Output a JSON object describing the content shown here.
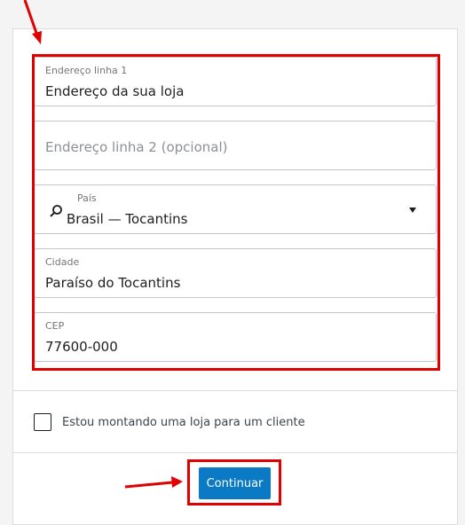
{
  "form": {
    "address1": {
      "label": "Endereço linha 1",
      "value": "Endereço da sua loja"
    },
    "address2": {
      "placeholder": "Endereço linha 2 (opcional)"
    },
    "country": {
      "label": "País",
      "value": "Brasil — Tocantins"
    },
    "city": {
      "label": "Cidade",
      "value": "Paraíso do Tocantins"
    },
    "postcode": {
      "label": "CEP",
      "value": "77600-000"
    }
  },
  "client_checkbox": {
    "label": "Estou montando uma loja para um cliente",
    "checked": false
  },
  "actions": {
    "continue_label": "Continuar"
  },
  "colors": {
    "annotation": "#e00000",
    "primary": "#0a7ac4"
  }
}
